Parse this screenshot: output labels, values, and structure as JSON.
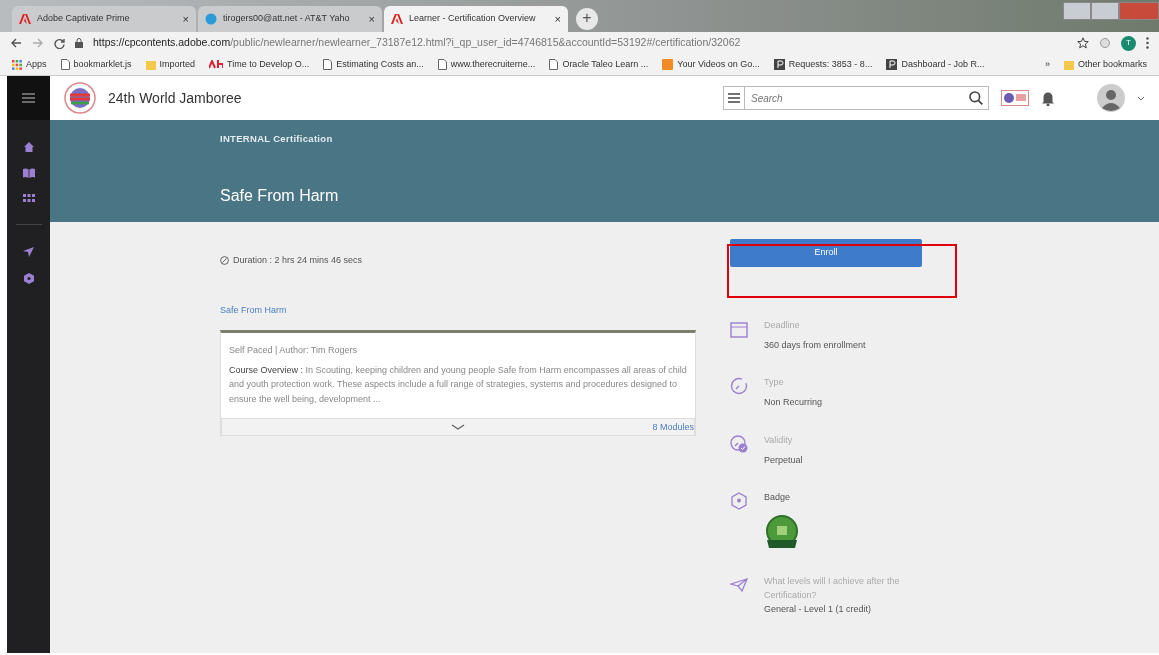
{
  "browser": {
    "tabs": [
      {
        "title": "Adobe Captivate Prime",
        "close": "×",
        "selected": false
      },
      {
        "title": "tirogers00@att.net - AT&T Yaho",
        "close": "×",
        "selected": false
      },
      {
        "title": "Learner - Certification Overview",
        "close": "×",
        "selected": true
      }
    ],
    "new_tab": "+",
    "url_host": "https://cpcontents.adobe.com",
    "url_path": "/public/newlearner/newlearner_73187e12.html?i_qp_user_id=4746815&accountId=53192#/certification/32062",
    "profile_initial": "T",
    "bookmarks": [
      {
        "label": "Apps"
      },
      {
        "label": "bookmarklet.js"
      },
      {
        "label": "Imported"
      },
      {
        "label": "Time to Develop O..."
      },
      {
        "label": "Estimating Costs an..."
      },
      {
        "label": "www.therecruiterne..."
      },
      {
        "label": "Oracle Taleo Learn ..."
      },
      {
        "label": "Your Videos on Go..."
      },
      {
        "label": "Requests: 3853 - 8..."
      },
      {
        "label": "Dashboard - Job R..."
      }
    ],
    "more": "»",
    "other_bookmarks": "Other bookmarks"
  },
  "app": {
    "title": "24th World Jamboree",
    "search": {
      "placeholder": "Search"
    },
    "banner": {
      "kicker": "INTERNAL Certification",
      "title": "Safe From Harm"
    },
    "duration": "Duration : 2 hrs 24 mins 46 secs",
    "course_link": "Safe From Harm",
    "course": {
      "meta": "Self Paced | Author: Tim Rogers",
      "overview_label": "Course Overview :",
      "overview": "In Scouting, keeping children and young people Safe from Harm encompasses all areas of child and youth protection work. These aspects include a full range of strategies, systems and procedures designed to ensure the well being, development ...",
      "modules": "8 Modules"
    },
    "enroll": "Enroll",
    "details": [
      {
        "kind": "deadline",
        "label": "Deadline",
        "value": "360 days from enrollment"
      },
      {
        "kind": "type",
        "label": "Type",
        "value": "Non Recurring"
      },
      {
        "kind": "validity",
        "label": "Validity",
        "value": "Perpetual"
      },
      {
        "kind": "badge",
        "label": "Badge"
      },
      {
        "kind": "levels",
        "label": "What levels will I achieve after the Certification?",
        "value": "General - Level 1 (1 credit)"
      }
    ]
  }
}
